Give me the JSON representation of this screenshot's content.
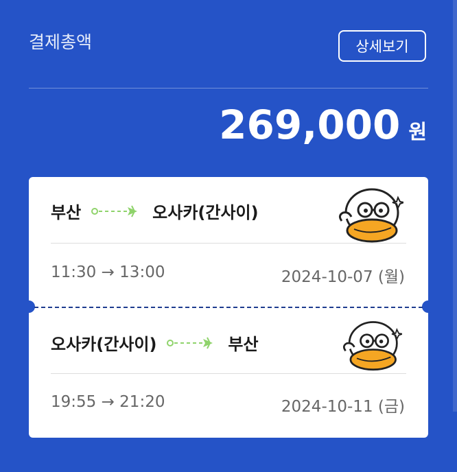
{
  "summary": {
    "label": "결제총액",
    "detail_button": "상세보기",
    "amount": "269,000",
    "currency": "원"
  },
  "flights": [
    {
      "from": "부산",
      "to": "오사카(간사이)",
      "time": "11:30 → 13:00",
      "date": "2024-10-07 (월)",
      "mascot_icon": "duck-mascot-icon"
    },
    {
      "from": "오사카(간사이)",
      "to": "부산",
      "time": "19:55 → 21:20",
      "date": "2024-10-11 (금)",
      "mascot_icon": "duck-mascot-icon"
    }
  ],
  "colors": {
    "background": "#2553c7",
    "accent_green": "#8fd36b",
    "separator": "#1d3c8f",
    "text_dark": "#1a1a1a",
    "text_muted": "#666666"
  }
}
